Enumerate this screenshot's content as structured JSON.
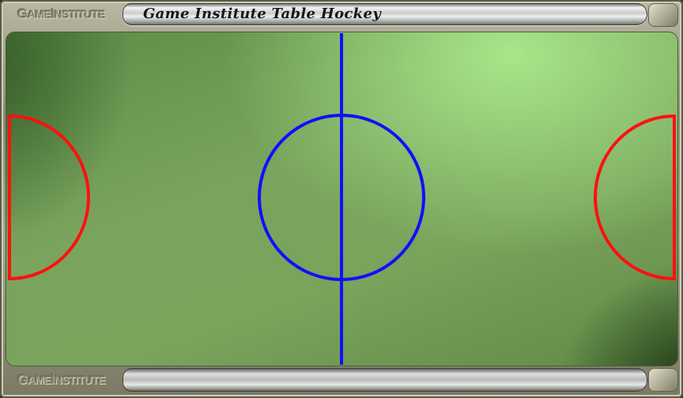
{
  "window": {
    "title": "Game Institute Table Hockey",
    "logo_prefix": "G",
    "logo_word1": "AME",
    "logo_i": "I",
    "logo_word2": "NSTITUTE"
  },
  "rink": {
    "center_line_color": "#1010ff",
    "center_circle_color": "#1010ff",
    "goal_crease_color": "#ff1010"
  }
}
